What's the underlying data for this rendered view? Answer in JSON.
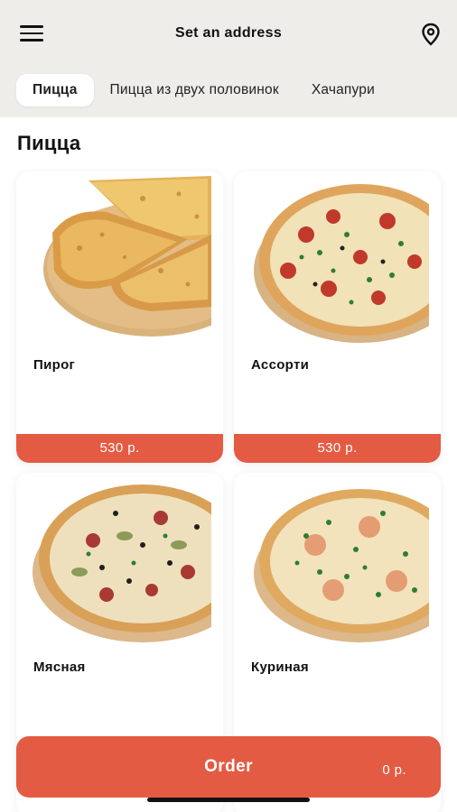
{
  "header": {
    "address_label": "Set an address",
    "menu_icon": "hamburger-menu-icon",
    "location_icon": "map-pin-icon"
  },
  "tabs": [
    {
      "label": "Пицца",
      "active": true
    },
    {
      "label": "Пицца из двух половинок",
      "active": false
    },
    {
      "label": "Хачапури",
      "active": false
    }
  ],
  "section": {
    "title": "Пицца"
  },
  "products": [
    {
      "name": "Пирог",
      "price": "530 р."
    },
    {
      "name": "Ассорти",
      "price": "530 р."
    },
    {
      "name": "Мясная",
      "price": ""
    },
    {
      "name": "Куриная",
      "price": ""
    }
  ],
  "order": {
    "label": "Order",
    "total": "0 р."
  },
  "colors": {
    "accent": "#e45b43",
    "header_bg": "#efedea"
  }
}
